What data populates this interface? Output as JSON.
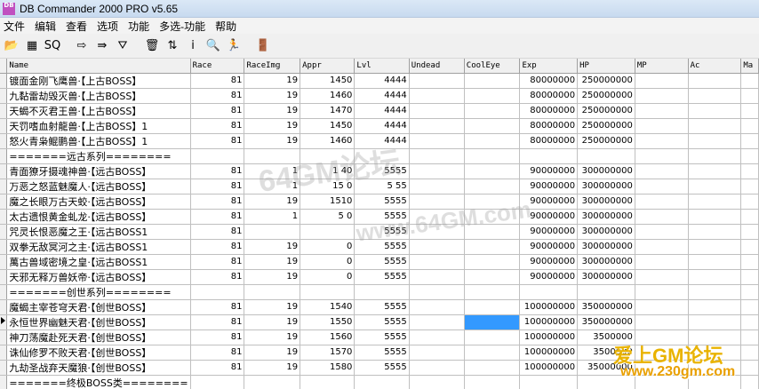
{
  "window": {
    "title": "DB Commander 2000 PRO v5.65",
    "icon_label": "DB"
  },
  "menu": [
    {
      "label": "文件"
    },
    {
      "label": "编辑"
    },
    {
      "label": "查看"
    },
    {
      "label": "选项"
    },
    {
      "label": "功能"
    },
    {
      "label": "多选-功能"
    },
    {
      "label": "帮助"
    }
  ],
  "toolbar": [
    {
      "icon": "open-folder-icon",
      "glyph": "📂"
    },
    {
      "icon": "table-icon",
      "glyph": "▦"
    },
    {
      "icon": "sql-icon",
      "glyph": "SQ"
    },
    {
      "icon": "arrow-right-icon",
      "glyph": "⇨"
    },
    {
      "icon": "export-icon",
      "glyph": "⇛"
    },
    {
      "icon": "filter-icon",
      "glyph": "⛛"
    },
    {
      "icon": "trash-icon",
      "glyph": "🗑"
    },
    {
      "icon": "sort-icon",
      "glyph": "⇅"
    },
    {
      "icon": "info-icon",
      "glyph": "i"
    },
    {
      "icon": "search-icon",
      "glyph": "🔍"
    },
    {
      "icon": "run-icon",
      "glyph": "🏃"
    },
    {
      "icon": "exit-icon",
      "glyph": "🚪"
    }
  ],
  "grid": {
    "columns": [
      "Name",
      "Race",
      "RaceImg",
      "Appr",
      "Lvl",
      "Undead",
      "CoolEye",
      "Exp",
      "HP",
      "MP",
      "Ac",
      "Ma"
    ],
    "rows": [
      {
        "name": "镀面金刚飞鹰兽·【上古BOSS】",
        "race": "81",
        "raceimg": "19",
        "appr": "1450",
        "lvl": "4444",
        "undead": "",
        "cooleye": "",
        "exp": "80000000",
        "hp": "250000000",
        "mp": "",
        "ac": ""
      },
      {
        "name": "九黏雷劫毁灭兽·【上古BOSS】",
        "race": "81",
        "raceimg": "19",
        "appr": "1460",
        "lvl": "4444",
        "undead": "",
        "cooleye": "",
        "exp": "80000000",
        "hp": "250000000",
        "mp": "",
        "ac": ""
      },
      {
        "name": "天蝎不灭君王兽·【上古BOSS】",
        "race": "81",
        "raceimg": "19",
        "appr": "1470",
        "lvl": "4444",
        "undead": "",
        "cooleye": "",
        "exp": "80000000",
        "hp": "250000000",
        "mp": "",
        "ac": ""
      },
      {
        "name": "天罚嗜血射龍兽·【上古BOSS】1",
        "race": "81",
        "raceimg": "19",
        "appr": "1450",
        "lvl": "4444",
        "undead": "",
        "cooleye": "",
        "exp": "80000000",
        "hp": "250000000",
        "mp": "",
        "ac": ""
      },
      {
        "name": "怒火青枭鲲鹏兽·【上古BOSS】1",
        "race": "81",
        "raceimg": "19",
        "appr": "1460",
        "lvl": "4444",
        "undead": "",
        "cooleye": "",
        "exp": "80000000",
        "hp": "250000000",
        "mp": "",
        "ac": ""
      },
      {
        "name": "=======远古系列========",
        "race": "",
        "raceimg": "",
        "appr": "",
        "lvl": "",
        "undead": "",
        "cooleye": "",
        "exp": "",
        "hp": "",
        "mp": "",
        "ac": ""
      },
      {
        "name": "青面獠牙摄魂神兽·【远古BOSS】",
        "race": "81",
        "raceimg": "1",
        "appr": "1 40",
        "lvl": "5555",
        "undead": "",
        "cooleye": "",
        "exp": "90000000",
        "hp": "300000000",
        "mp": "",
        "ac": ""
      },
      {
        "name": "万恶之怒蓝魅魔人·【远古BOSS】",
        "race": "81",
        "raceimg": "1",
        "appr": "15 0",
        "lvl": "5 55",
        "undead": "",
        "cooleye": "",
        "exp": "90000000",
        "hp": "300000000",
        "mp": "",
        "ac": ""
      },
      {
        "name": "魔之长眼万古天蛟·【远古BOSS】",
        "race": "81",
        "raceimg": "19",
        "appr": "1510",
        "lvl": "5555",
        "undead": "",
        "cooleye": "",
        "exp": "90000000",
        "hp": "300000000",
        "mp": "",
        "ac": ""
      },
      {
        "name": "太古遗恨黄金虬龙·【远古BOSS】",
        "race": "81",
        "raceimg": "1",
        "appr": "5 0",
        "lvl": "5555",
        "undead": "",
        "cooleye": "",
        "exp": "90000000",
        "hp": "300000000",
        "mp": "",
        "ac": ""
      },
      {
        "name": "咒灵长恨恶魔之王·【远古BOSS1",
        "race": "81",
        "raceimg": "",
        "appr": "",
        "lvl": "5555",
        "undead": "",
        "cooleye": "",
        "exp": "90000000",
        "hp": "300000000",
        "mp": "",
        "ac": ""
      },
      {
        "name": "双拳无敌冥河之主·【远古BOSS1",
        "race": "81",
        "raceimg": "19",
        "appr": "0",
        "lvl": "5555",
        "undead": "",
        "cooleye": "",
        "exp": "90000000",
        "hp": "300000000",
        "mp": "",
        "ac": ""
      },
      {
        "name": "萬古兽域密境之皇·【远古BOSS1",
        "race": "81",
        "raceimg": "19",
        "appr": "0",
        "lvl": "5555",
        "undead": "",
        "cooleye": "",
        "exp": "90000000",
        "hp": "300000000",
        "mp": "",
        "ac": ""
      },
      {
        "name": "天邪无释万兽妖帝·【远古BOSS】",
        "race": "81",
        "raceimg": "19",
        "appr": "0",
        "lvl": "5555",
        "undead": "",
        "cooleye": "",
        "exp": "90000000",
        "hp": "300000000",
        "mp": "",
        "ac": ""
      },
      {
        "name": "=======创世系列========",
        "race": "",
        "raceimg": "",
        "appr": "",
        "lvl": "",
        "undead": "",
        "cooleye": "",
        "exp": "",
        "hp": "",
        "mp": "",
        "ac": ""
      },
      {
        "name": "魔蝎主宰苍穹天君·【创世BOSS】",
        "race": "81",
        "raceimg": "19",
        "appr": "1540",
        "lvl": "5555",
        "undead": "",
        "cooleye": "",
        "exp": "100000000",
        "hp": "350000000",
        "mp": "",
        "ac": ""
      },
      {
        "name": "永恒世界幽魅天君·【创世BOSS】",
        "race": "81",
        "raceimg": "19",
        "appr": "1550",
        "lvl": "5555",
        "undead": "",
        "cooleye": "",
        "exp": "100000000",
        "hp": "350000000",
        "mp": "",
        "ac": "",
        "current": true,
        "selected_col": "cooleye"
      },
      {
        "name": "神刀荡魔赴死天君·【创世BOSS】",
        "race": "81",
        "raceimg": "19",
        "appr": "1560",
        "lvl": "5555",
        "undead": "",
        "cooleye": "",
        "exp": "100000000",
        "hp": "3500000",
        "mp": "",
        "ac": ""
      },
      {
        "name": "诛仙修罗不败天君·【创世BOSS】",
        "race": "81",
        "raceimg": "19",
        "appr": "1570",
        "lvl": "5555",
        "undead": "",
        "cooleye": "",
        "exp": "100000000",
        "hp": "3500000",
        "mp": "",
        "ac": ""
      },
      {
        "name": "九劫圣战弃天魔狼·【创世BOSS】",
        "race": "81",
        "raceimg": "19",
        "appr": "1580",
        "lvl": "5555",
        "undead": "",
        "cooleye": "",
        "exp": "100000000",
        "hp": "35000000",
        "mp": "",
        "ac": ""
      },
      {
        "name": "=======终极BOSS类========",
        "race": "",
        "raceimg": "",
        "appr": "",
        "lvl": "",
        "undead": "",
        "cooleye": "",
        "exp": "",
        "hp": "",
        "mp": "",
        "ac": ""
      }
    ]
  },
  "watermarks": {
    "top": "64GM论坛",
    "mid": "www.64GM.com",
    "brand": "爱上GM论坛",
    "url": "www.230gm.com"
  }
}
